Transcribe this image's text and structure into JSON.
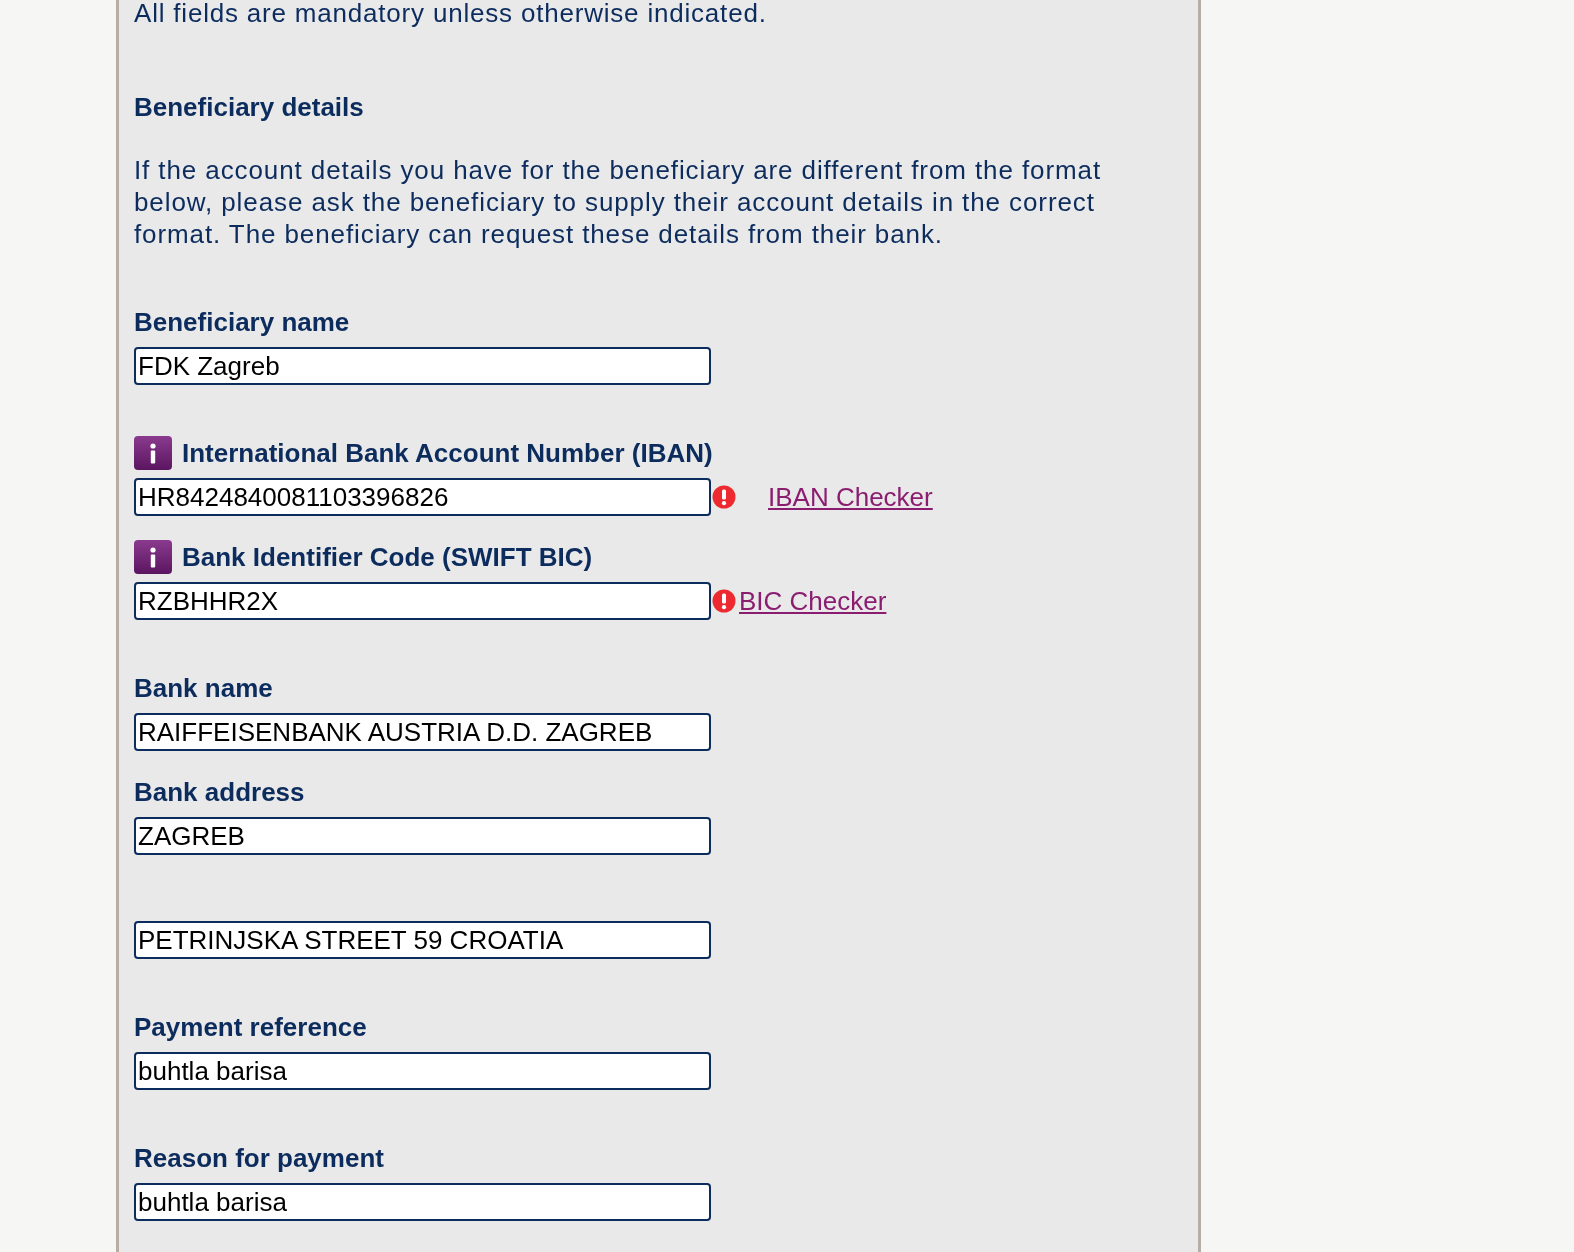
{
  "intro": "All fields are mandatory unless otherwise indicated.",
  "section": {
    "title": "Beneficiary details",
    "description": "If the account details you have for the beneficiary are different from the format below, please ask the beneficiary to supply their account details in the correct format. The beneficiary can request these details from their bank."
  },
  "groups": [
    {
      "fields": [
        {
          "label": "Beneficiary name",
          "value": "FDK Zagreb",
          "info": false,
          "error": false
        }
      ]
    },
    {
      "fields": [
        {
          "label": "International Bank Account Number (IBAN)",
          "value": "HR8424840081103396826",
          "info": true,
          "error": true,
          "link": "IBAN Checker"
        },
        {
          "label": "Bank Identifier Code (SWIFT BIC)",
          "value": "RZBHHR2X",
          "info": true,
          "error": true,
          "link": "BIC Checker"
        }
      ]
    },
    {
      "fields": [
        {
          "label": "Bank name",
          "value": "RAIFFEISENBANK AUSTRIA D.D. ZAGREB",
          "info": false,
          "error": false
        },
        {
          "label": "Bank address",
          "value": "ZAGREB",
          "info": false,
          "error": false
        },
        {
          "value": "PETRINJSKA STREET 59 CROATIA",
          "info": false,
          "error": false
        }
      ]
    },
    {
      "fields": [
        {
          "label": "Payment reference",
          "value": "buhtla barisa",
          "info": false,
          "error": false
        }
      ]
    },
    {
      "fields": [
        {
          "label": "Reason for payment",
          "value": "buhtla barisa",
          "info": false,
          "error": false
        }
      ]
    }
  ]
}
